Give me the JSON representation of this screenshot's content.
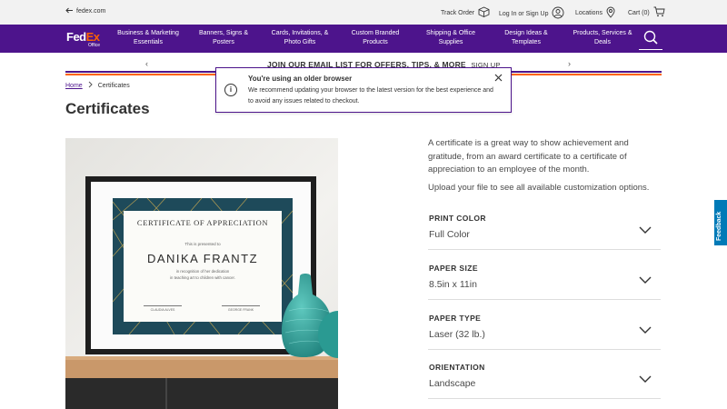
{
  "utility_bar": {
    "back_link": "fedex.com",
    "track_order": "Track Order",
    "login": "Log In or Sign Up",
    "locations": "Locations",
    "cart": "Cart (0)"
  },
  "logo": {
    "fed": "Fed",
    "ex": "Ex",
    "sub": "Office"
  },
  "nav": {
    "items": [
      {
        "label": "Business & Marketing\nEssentials"
      },
      {
        "label": "Banners, Signs &\nPosters"
      },
      {
        "label": "Cards, Invitations, &\nPhoto Gifts"
      },
      {
        "label": "Custom Branded\nProducts"
      },
      {
        "label": "Shipping & Office\nSupplies"
      },
      {
        "label": "Design Ideas &\nTemplates"
      },
      {
        "label": "Products, Services &\nDeals"
      }
    ]
  },
  "promo": {
    "text": "JOIN OUR EMAIL LIST FOR OFFERS, TIPS, & MORE",
    "link": "SIGN UP"
  },
  "breadcrumb": {
    "home": "Home",
    "current": "Certificates"
  },
  "page_title": "Certificates",
  "alert": {
    "title": "You're using an older browser",
    "body": "We recommend updating your browser to the latest version for the best experience and to avoid any issues related to checkout."
  },
  "certificate_image": {
    "heading": "CERTIFICATE OF APPRECIATION",
    "presented": "This is presented to",
    "name": "DANIKA FRANTZ",
    "line1": "in recognition of her dedication",
    "line2": "in teaching art to children with cancer.",
    "sig1": "CLAUDIA ALVES",
    "sig2": "GEORGE FRANK"
  },
  "product": {
    "description": "A certificate is a great way to show achievement and gratitude, from an award certificate to a certificate of appreciation to an employee of the month.",
    "upload_note": "Upload your file to see all available customization options.",
    "options": [
      {
        "label": "PRINT COLOR",
        "value": "Full Color"
      },
      {
        "label": "PAPER SIZE",
        "value": "8.5in x 11in"
      },
      {
        "label": "PAPER TYPE",
        "value": "Laser (32 lb.)"
      },
      {
        "label": "ORIENTATION",
        "value": "Landscape"
      }
    ]
  },
  "feedback": "Feedback",
  "colors": {
    "brand_purple": "#4d148c",
    "brand_orange": "#ff6200",
    "feedback_blue": "#007ab7"
  }
}
